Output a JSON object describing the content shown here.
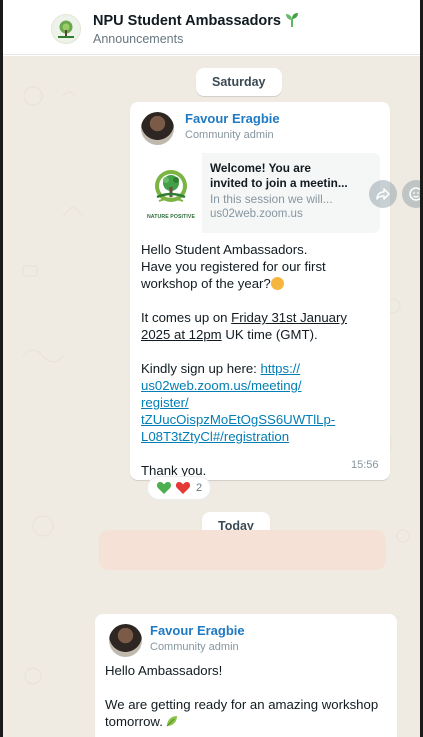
{
  "header": {
    "title": "NPU Student Ambassadors",
    "subtitle": "Announcements"
  },
  "chat": {
    "date_1": "Saturday",
    "date_2": "Today",
    "message_1": {
      "sender": "Favour Eragbie",
      "role": "Community admin",
      "link_preview": {
        "title_line_1": "Welcome! You are",
        "title_line_2": "invited to join a meetin...",
        "description": "In this session we will...",
        "domain": "us02web.zoom.us",
        "thumb_caption": "NATURE POSITIVE"
      },
      "line_1": "Hello Student Ambassadors.",
      "line_2": "Have you registered for our first",
      "line_3": "workshop of the year?",
      "line_4": "It comes up on ",
      "line_4_date_a": "Friday 31st January",
      "line_5_date_b": "2025 at 12pm",
      "line_5_rest": " UK time (GMT).",
      "line_6": "Kindly sign up here: ",
      "url_1": "https://",
      "url_2": "us02web.zoom.us/meeting/",
      "url_3": "register/",
      "url_4": "tZUucOispzMoEtOgSS6UWTlLp-",
      "url_5": "L08T3tZtyCl#/registration",
      "thanks": "Thank you.",
      "time": "15:56",
      "reaction_count": "2"
    },
    "message_2": {
      "sender": "Favour Eragbie",
      "role": "Community admin",
      "line_1": "Hello Ambassadors!",
      "line_2": "We are getting ready for an amazing workshop",
      "line_3": "tomorrow."
    }
  },
  "icons": {
    "forward": "forward-icon",
    "emoji": "emoji-icon",
    "group_logo": "group-logo-icon",
    "sprout": "sprout-icon"
  },
  "colors": {
    "chat_bg": "#efeae2",
    "sender": "#1f7ac4",
    "link": "#027eb5",
    "placeholder_bubble": "#f5e1d6"
  }
}
